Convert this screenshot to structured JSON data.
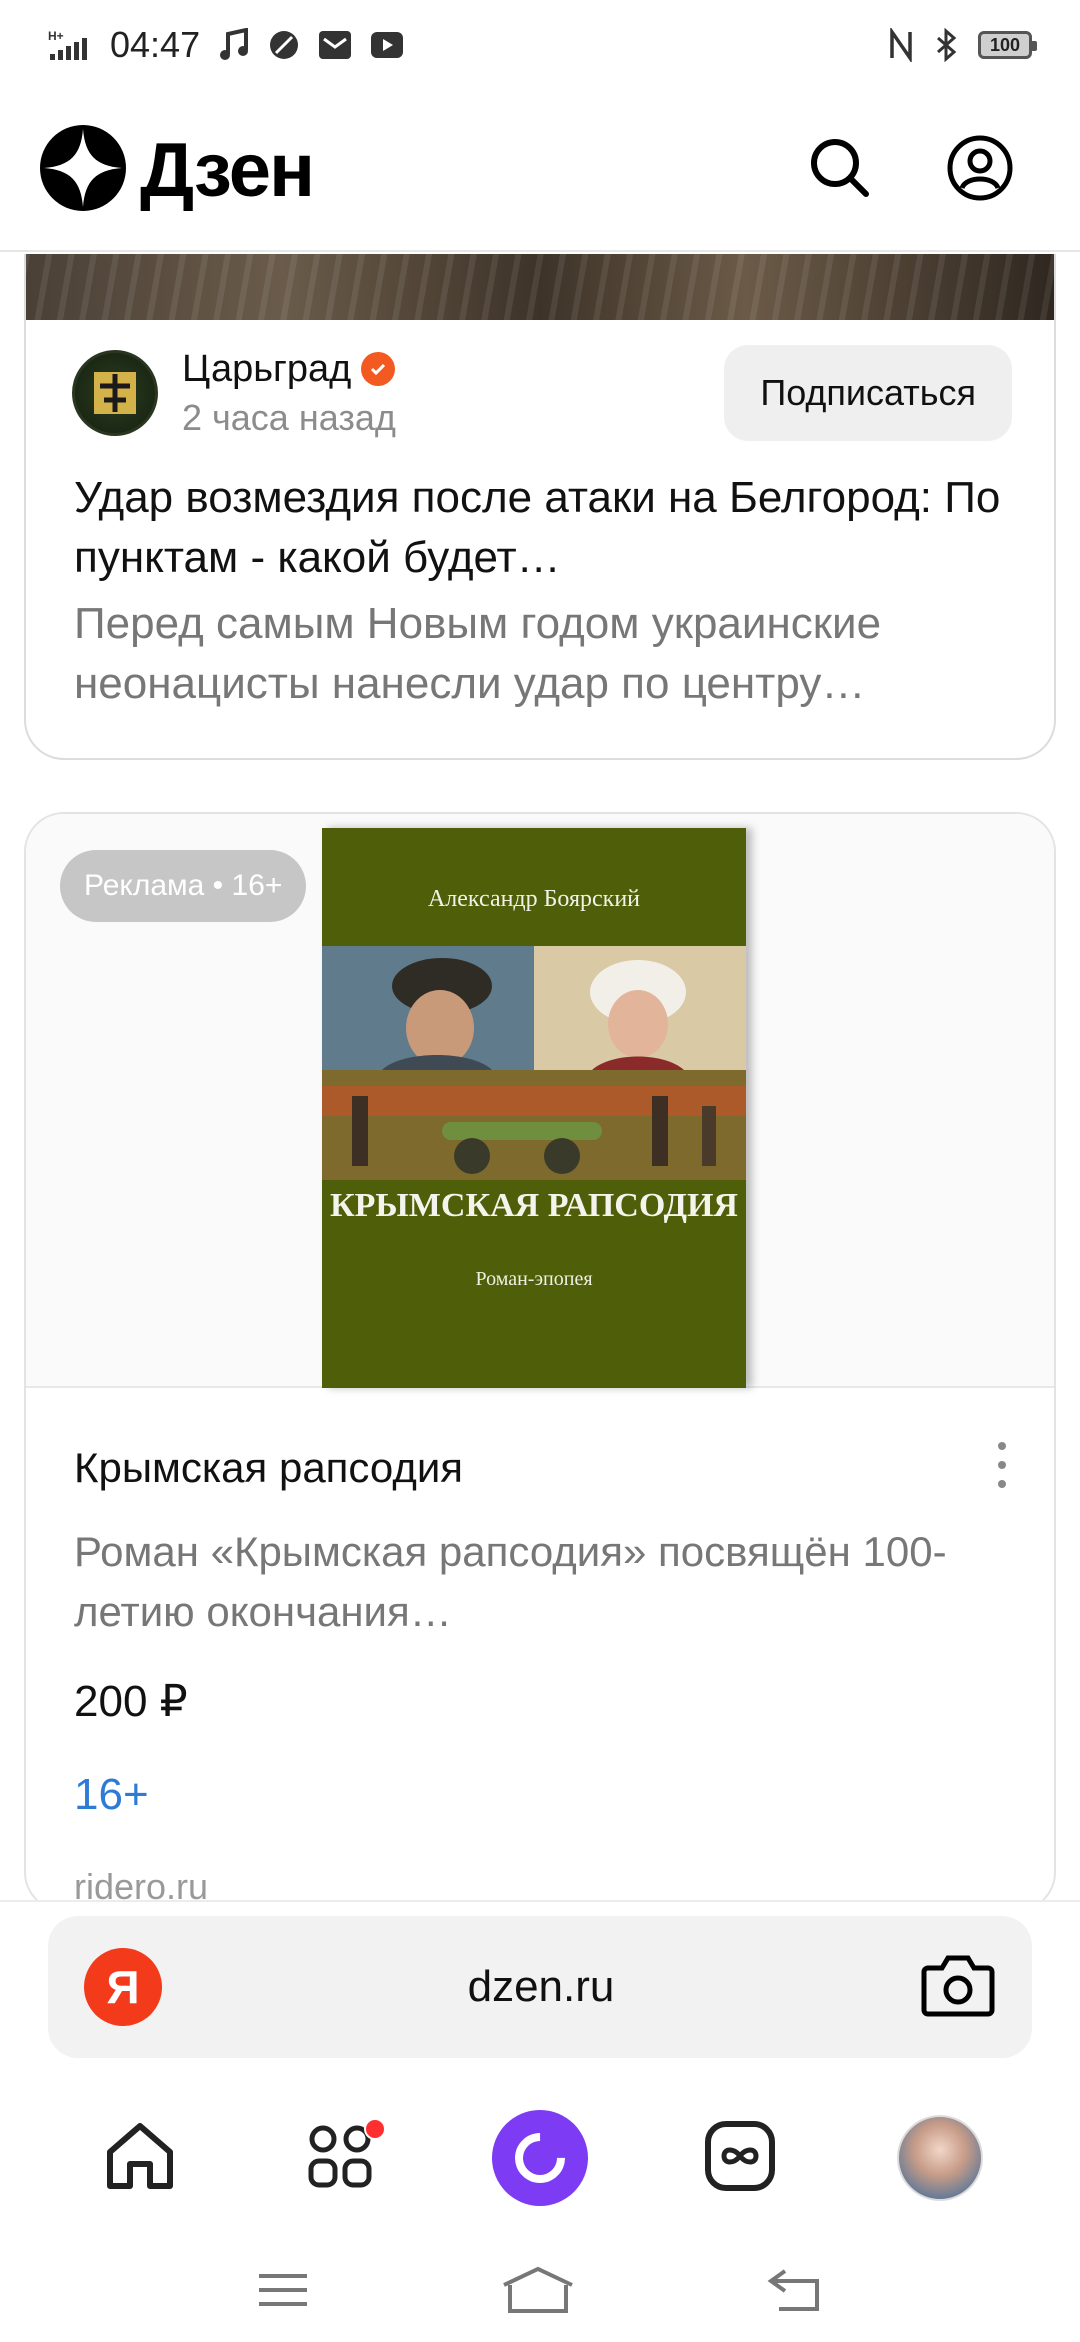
{
  "status_bar": {
    "network": "H+",
    "time": "04:47",
    "battery": "100"
  },
  "header": {
    "logo_text": "Дзен"
  },
  "post": {
    "channel_name": "Царьград",
    "time_ago": "2 часа назад",
    "subscribe_label": "Подписаться",
    "title": "Удар возмездия после атаки на Белгород: По пунктам - какой будет…",
    "excerpt": "Перед самым Новым годом украинские неонацисты нанесли удар по центру…"
  },
  "ad": {
    "badge": "Реклама • 16+",
    "book_author": "Александр Боярский",
    "book_title": "КРЫМСКАЯ РАПСОДИЯ",
    "book_subtitle": "Роман-эпопея",
    "title": "Крымская рапсодия",
    "description": "Роман «Крымская рапсодия» посвящён 100-летию окончания…",
    "price": "200 ₽",
    "age_rating": "16+",
    "domain": "ridero.ru"
  },
  "browser": {
    "address_logo": "Я",
    "url": "dzen.ru"
  },
  "colors": {
    "verified_badge": "#f25a21",
    "alice_button": "#7d3cf3",
    "yandex_logo": "#f33a1a",
    "age_link": "#2e7bd6",
    "book_cover": "#4f5e08",
    "notification_dot": "#ff2f2f"
  },
  "icons": {
    "status_left": [
      "signal-icon",
      "music-icon",
      "leaf-icon",
      "mail-icon",
      "youtube-icon"
    ],
    "status_right": [
      "nfc-icon",
      "bluetooth-icon",
      "battery-icon"
    ],
    "header": [
      "dzen-logo-icon",
      "search-icon",
      "profile-icon"
    ],
    "bottom_nav": [
      "home-icon",
      "services-icon",
      "alice-icon",
      "subscriptions-icon",
      "user-avatar"
    ],
    "system_nav": [
      "menu-icon",
      "home-nav-icon",
      "back-icon"
    ]
  }
}
